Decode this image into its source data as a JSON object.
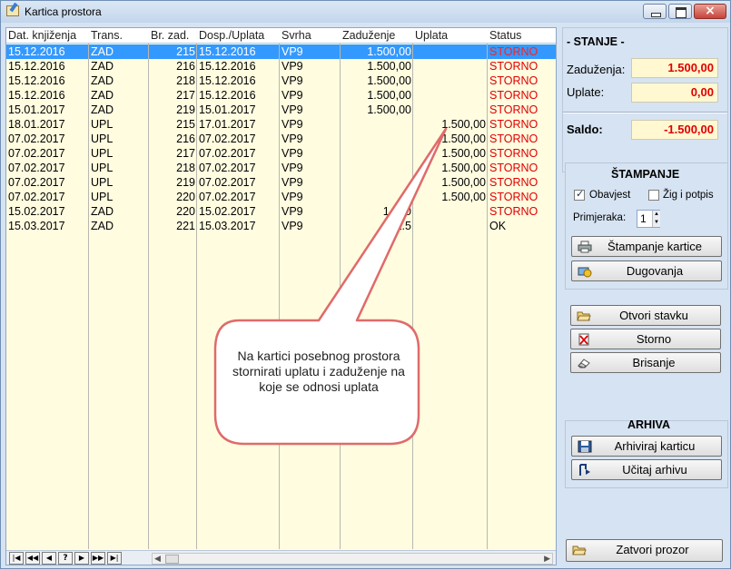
{
  "window": {
    "title": "Kartica prostora"
  },
  "grid": {
    "columns": [
      "Dat. knjiženja",
      "Trans.",
      "Br. zad.",
      "Dosp./Uplata",
      "Svrha",
      "Zaduženje",
      "Uplata",
      "Status"
    ],
    "rows": [
      [
        "15.12.2016",
        "ZAD",
        "215",
        "15.12.2016",
        "VP9",
        "1.500,00",
        "",
        "STORNO"
      ],
      [
        "15.12.2016",
        "ZAD",
        "216",
        "15.12.2016",
        "VP9",
        "1.500,00",
        "",
        "STORNO"
      ],
      [
        "15.12.2016",
        "ZAD",
        "218",
        "15.12.2016",
        "VP9",
        "1.500,00",
        "",
        "STORNO"
      ],
      [
        "15.12.2016",
        "ZAD",
        "217",
        "15.12.2016",
        "VP9",
        "1.500,00",
        "",
        "STORNO"
      ],
      [
        "15.01.2017",
        "ZAD",
        "219",
        "15.01.2017",
        "VP9",
        "1.500,00",
        "",
        "STORNO"
      ],
      [
        "18.01.2017",
        "UPL",
        "215",
        "17.01.2017",
        "VP9",
        "",
        "1.500,00",
        "STORNO"
      ],
      [
        "07.02.2017",
        "UPL",
        "216",
        "07.02.2017",
        "VP9",
        "",
        "1.500,00",
        "STORNO"
      ],
      [
        "07.02.2017",
        "UPL",
        "217",
        "07.02.2017",
        "VP9",
        "",
        "1.500,00",
        "STORNO"
      ],
      [
        "07.02.2017",
        "UPL",
        "218",
        "07.02.2017",
        "VP9",
        "",
        "1.500,00",
        "STORNO"
      ],
      [
        "07.02.2017",
        "UPL",
        "219",
        "07.02.2017",
        "VP9",
        "",
        "1.500,00",
        "STORNO"
      ],
      [
        "07.02.2017",
        "UPL",
        "220",
        "07.02.2017",
        "VP9",
        "",
        "1.500,00",
        "STORNO"
      ],
      [
        "15.02.2017",
        "ZAD",
        "220",
        "15.02.2017",
        "VP9",
        "1.500",
        "",
        "STORNO"
      ],
      [
        "15.03.2017",
        "ZAD",
        "221",
        "15.03.2017",
        "VP9",
        "1.5",
        "",
        "OK"
      ]
    ],
    "selected_row": 0
  },
  "callout": {
    "text": "Na kartici posebnog prostora stornirati uplatu i zaduženje na koje se odnosi uplata"
  },
  "stanje": {
    "title": "- STANJE -",
    "zaduzenja_label": "Zaduženja:",
    "zaduzenja_value": "1.500,00",
    "uplate_label": "Uplate:",
    "uplate_value": "0,00",
    "saldo_label": "Saldo:",
    "saldo_value": "-1.500,00"
  },
  "stampanje": {
    "title": "ŠTAMPANJE",
    "obavijest_label": "Obavjest",
    "obavijest_checked": true,
    "zig_label": "Žig i potpis",
    "zig_checked": false,
    "primjeraka_label": "Primjeraka:",
    "primjeraka_value": "1",
    "stampanje_kartice": "Štampanje kartice",
    "dugovanja": "Dugovanja"
  },
  "stavka": {
    "otvori": "Otvori stavku",
    "storno": "Storno",
    "brisanje": "Brisanje"
  },
  "arhiva": {
    "title": "ARHIVA",
    "arhiviraj": "Arhiviraj karticu",
    "ucitaj": "Učitaj arhivu"
  },
  "footer": {
    "zatvori": "Zatvori prozor"
  },
  "colors": {
    "storno": "#e00000",
    "selection": "#3399ff",
    "grid_bg": "#fffce0"
  }
}
